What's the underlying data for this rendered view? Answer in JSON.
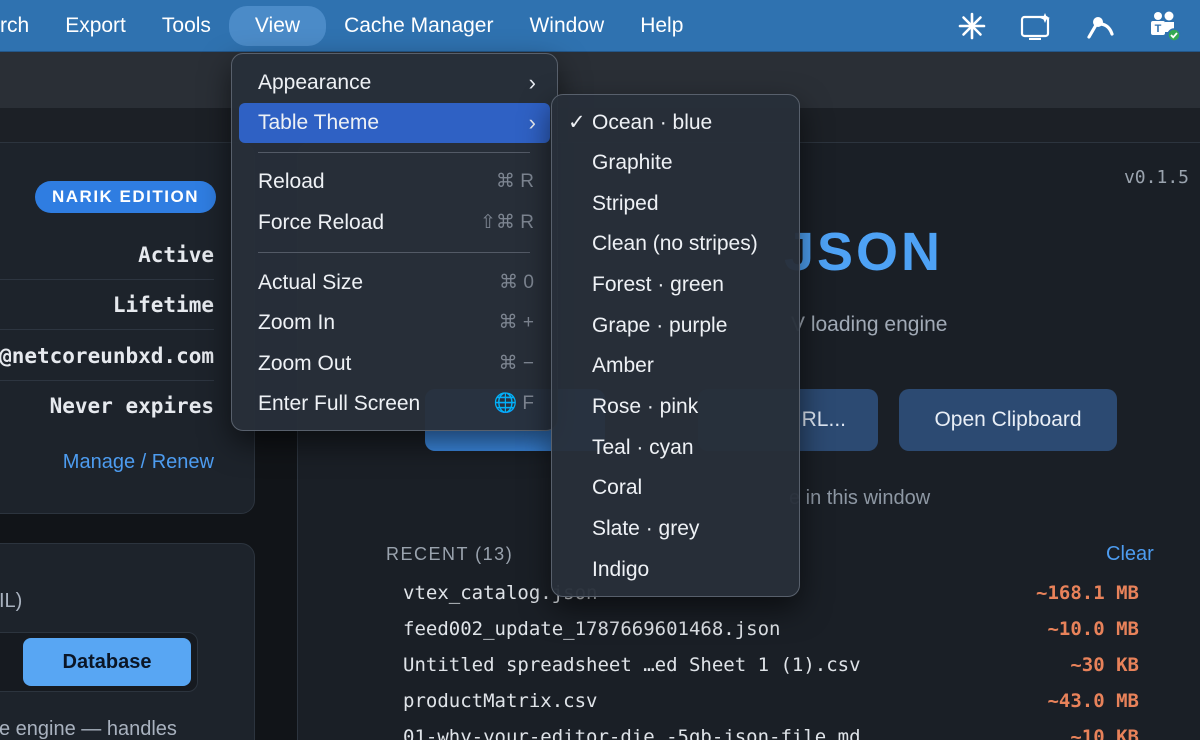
{
  "menubar": {
    "items": [
      "rch",
      "Export",
      "Tools",
      "View",
      "Cache Manager",
      "Window",
      "Help"
    ],
    "open_item": "View"
  },
  "tray_icons": [
    "sparkle-icon",
    "screen-sparkle-icon",
    "tool-icon",
    "teams-icon"
  ],
  "license": {
    "edition_badge": "NARIK EDITION",
    "rows": [
      "Active",
      "Lifetime",
      "@netcoreunbxd.com",
      "Never expires"
    ],
    "manage_link": "Manage / Renew"
  },
  "source_panel": {
    "hint": "IL)",
    "segment_selected": "Database",
    "engine_hint": "e engine — handles"
  },
  "main": {
    "version": "v0.1.5",
    "hero_title": "JSON",
    "subtitle": "V loading engine",
    "primary_button": "",
    "url_button": "RL...",
    "clipboard_button": "Open Clipboard",
    "hint": "e in this window",
    "recent_header": "RECENT (13)",
    "clear_label": "Clear",
    "recent": [
      {
        "name": "vtex_catalog.json",
        "size": "~168.1 MB"
      },
      {
        "name": "feed002_update_1787669601468.json",
        "size": "~10.0 MB"
      },
      {
        "name": "Untitled spreadsheet …ed Sheet 1 (1).csv",
        "size": "~30 KB"
      },
      {
        "name": "productMatrix.csv",
        "size": "~43.0 MB"
      },
      {
        "name": "01-why-your-editor-die…-5gb-json-file.md",
        "size": "~10 KB"
      }
    ]
  },
  "view_menu": {
    "appearance": "Appearance",
    "table_theme": "Table Theme",
    "reload": "Reload",
    "reload_sc": "⌘ R",
    "force_reload": "Force Reload",
    "force_reload_sc": "⇧⌘ R",
    "actual_size": "Actual Size",
    "actual_size_sc": "⌘ 0",
    "zoom_in": "Zoom In",
    "zoom_in_sc": "⌘ +",
    "zoom_out": "Zoom Out",
    "zoom_out_sc": "⌘ −",
    "full_screen": "Enter Full Screen",
    "full_screen_sc": "🌐 F",
    "arrow": "›"
  },
  "theme_menu": {
    "checkmark": "✓",
    "selected_index": 0,
    "items": [
      "Ocean · blue",
      "Graphite",
      "Striped",
      "Clean (no stripes)",
      "Forest · green",
      "Grape · purple",
      "Amber",
      "Rose · pink",
      "Teal · cyan",
      "Coral",
      "Slate · grey",
      "Indigo"
    ]
  },
  "colors": {
    "menubar": "#2f72b0",
    "accent": "#4ea2f5",
    "highlight": "#2f61c4",
    "size_text": "#e8825a"
  }
}
